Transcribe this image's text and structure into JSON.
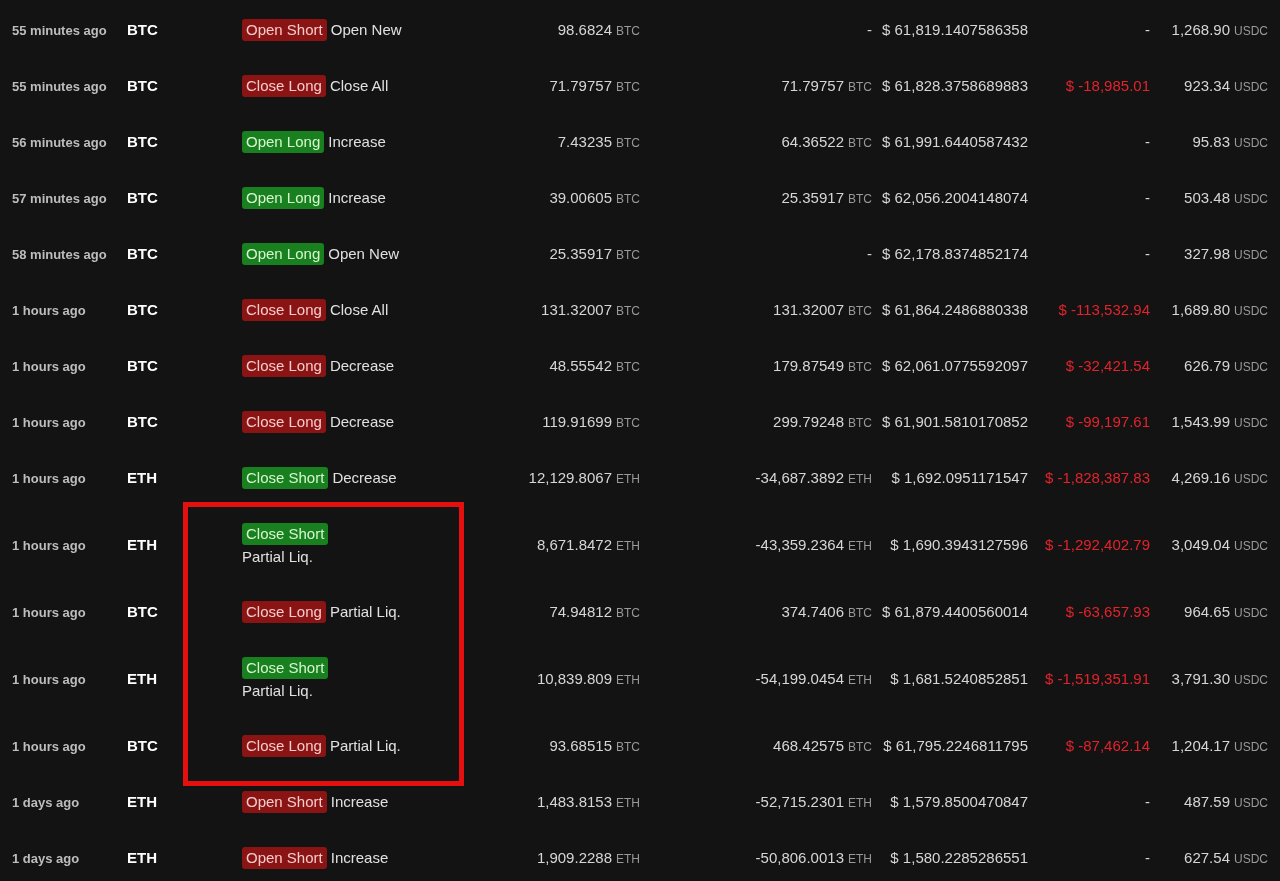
{
  "trades": [
    {
      "time": "55 minutes ago",
      "coin": "BTC",
      "side": {
        "label": "Open Short",
        "kind": "sell"
      },
      "action": "Open New",
      "size": {
        "value": "98.6824",
        "unit": "BTC"
      },
      "position": {
        "value": "-"
      },
      "price": "$ 61,819.1407586358",
      "pnl": {
        "value": "-",
        "kind": "neutral"
      },
      "fee": {
        "value": "1,268.90",
        "unit": "USDC"
      }
    },
    {
      "time": "55 minutes ago",
      "coin": "BTC",
      "side": {
        "label": "Close Long",
        "kind": "sell"
      },
      "action": "Close All",
      "size": {
        "value": "71.79757",
        "unit": "BTC"
      },
      "position": {
        "value": "71.79757",
        "unit": "BTC"
      },
      "price": "$ 61,828.3758689883",
      "pnl": {
        "value": "$ -18,985.01",
        "kind": "loss"
      },
      "fee": {
        "value": "923.34",
        "unit": "USDC"
      }
    },
    {
      "time": "56 minutes ago",
      "coin": "BTC",
      "side": {
        "label": "Open Long",
        "kind": "buy"
      },
      "action": "Increase",
      "size": {
        "value": "7.43235",
        "unit": "BTC"
      },
      "position": {
        "value": "64.36522",
        "unit": "BTC"
      },
      "price": "$ 61,991.6440587432",
      "pnl": {
        "value": "-",
        "kind": "neutral"
      },
      "fee": {
        "value": "95.83",
        "unit": "USDC"
      }
    },
    {
      "time": "57 minutes ago",
      "coin": "BTC",
      "side": {
        "label": "Open Long",
        "kind": "buy"
      },
      "action": "Increase",
      "size": {
        "value": "39.00605",
        "unit": "BTC"
      },
      "position": {
        "value": "25.35917",
        "unit": "BTC"
      },
      "price": "$ 62,056.2004148074",
      "pnl": {
        "value": "-",
        "kind": "neutral"
      },
      "fee": {
        "value": "503.48",
        "unit": "USDC"
      }
    },
    {
      "time": "58 minutes ago",
      "coin": "BTC",
      "side": {
        "label": "Open Long",
        "kind": "buy"
      },
      "action": "Open New",
      "size": {
        "value": "25.35917",
        "unit": "BTC"
      },
      "position": {
        "value": "-"
      },
      "price": "$ 62,178.8374852174",
      "pnl": {
        "value": "-",
        "kind": "neutral"
      },
      "fee": {
        "value": "327.98",
        "unit": "USDC"
      }
    },
    {
      "time": "1 hours ago",
      "coin": "BTC",
      "side": {
        "label": "Close Long",
        "kind": "sell"
      },
      "action": "Close All",
      "size": {
        "value": "131.32007",
        "unit": "BTC"
      },
      "position": {
        "value": "131.32007",
        "unit": "BTC"
      },
      "price": "$ 61,864.2486880338",
      "pnl": {
        "value": "$ -113,532.94",
        "kind": "loss"
      },
      "fee": {
        "value": "1,689.80",
        "unit": "USDC"
      }
    },
    {
      "time": "1 hours ago",
      "coin": "BTC",
      "side": {
        "label": "Close Long",
        "kind": "sell"
      },
      "action": "Decrease",
      "size": {
        "value": "48.55542",
        "unit": "BTC"
      },
      "position": {
        "value": "179.87549",
        "unit": "BTC"
      },
      "price": "$ 62,061.0775592097",
      "pnl": {
        "value": "$ -32,421.54",
        "kind": "loss"
      },
      "fee": {
        "value": "626.79",
        "unit": "USDC"
      }
    },
    {
      "time": "1 hours ago",
      "coin": "BTC",
      "side": {
        "label": "Close Long",
        "kind": "sell"
      },
      "action": "Decrease",
      "size": {
        "value": "119.91699",
        "unit": "BTC"
      },
      "position": {
        "value": "299.79248",
        "unit": "BTC"
      },
      "price": "$ 61,901.5810170852",
      "pnl": {
        "value": "$ -99,197.61",
        "kind": "loss"
      },
      "fee": {
        "value": "1,543.99",
        "unit": "USDC"
      }
    },
    {
      "time": "1 hours ago",
      "coin": "ETH",
      "side": {
        "label": "Close Short",
        "kind": "buy"
      },
      "action": "Decrease",
      "size": {
        "value": "12,129.8067",
        "unit": "ETH"
      },
      "position": {
        "value": "-34,687.3892",
        "unit": "ETH"
      },
      "price": "$ 1,692.0951171547",
      "pnl": {
        "value": "$ -1,828,387.83",
        "kind": "loss"
      },
      "fee": {
        "value": "4,269.16",
        "unit": "USDC"
      }
    },
    {
      "time": "1 hours ago",
      "coin": "ETH",
      "side": {
        "label": "Close Short",
        "kind": "buy"
      },
      "action": "Partial Liq.",
      "size": {
        "value": "8,671.8472",
        "unit": "ETH"
      },
      "position": {
        "value": "-43,359.2364",
        "unit": "ETH"
      },
      "price": "$ 1,690.3943127596",
      "pnl": {
        "value": "$ -1,292,402.79",
        "kind": "loss"
      },
      "fee": {
        "value": "3,049.04",
        "unit": "USDC"
      }
    },
    {
      "time": "1 hours ago",
      "coin": "BTC",
      "side": {
        "label": "Close Long",
        "kind": "sell"
      },
      "action": "Partial Liq.",
      "size": {
        "value": "74.94812",
        "unit": "BTC"
      },
      "position": {
        "value": "374.7406",
        "unit": "BTC"
      },
      "price": "$ 61,879.4400560014",
      "pnl": {
        "value": "$ -63,657.93",
        "kind": "loss"
      },
      "fee": {
        "value": "964.65",
        "unit": "USDC"
      }
    },
    {
      "time": "1 hours ago",
      "coin": "ETH",
      "side": {
        "label": "Close Short",
        "kind": "buy"
      },
      "action": "Partial Liq.",
      "size": {
        "value": "10,839.809",
        "unit": "ETH"
      },
      "position": {
        "value": "-54,199.0454",
        "unit": "ETH"
      },
      "price": "$ 1,681.5240852851",
      "pnl": {
        "value": "$ -1,519,351.91",
        "kind": "loss"
      },
      "fee": {
        "value": "3,791.30",
        "unit": "USDC"
      }
    },
    {
      "time": "1 hours ago",
      "coin": "BTC",
      "side": {
        "label": "Close Long",
        "kind": "sell"
      },
      "action": "Partial Liq.",
      "size": {
        "value": "93.68515",
        "unit": "BTC"
      },
      "position": {
        "value": "468.42575",
        "unit": "BTC"
      },
      "price": "$ 61,795.2246811795",
      "pnl": {
        "value": "$ -87,462.14",
        "kind": "loss"
      },
      "fee": {
        "value": "1,204.17",
        "unit": "USDC"
      }
    },
    {
      "time": "1 days ago",
      "coin": "ETH",
      "side": {
        "label": "Open Short",
        "kind": "sell"
      },
      "action": "Increase",
      "size": {
        "value": "1,483.8153",
        "unit": "ETH"
      },
      "position": {
        "value": "-52,715.2301",
        "unit": "ETH"
      },
      "price": "$ 1,579.8500470847",
      "pnl": {
        "value": "-",
        "kind": "neutral"
      },
      "fee": {
        "value": "487.59",
        "unit": "USDC"
      }
    },
    {
      "time": "1 days ago",
      "coin": "ETH",
      "side": {
        "label": "Open Short",
        "kind": "sell"
      },
      "action": "Increase",
      "size": {
        "value": "1,909.2288",
        "unit": "ETH"
      },
      "position": {
        "value": "-50,806.0013",
        "unit": "ETH"
      },
      "price": "$ 1,580.2285286551",
      "pnl": {
        "value": "-",
        "kind": "neutral"
      },
      "fee": {
        "value": "627.54",
        "unit": "USDC"
      }
    }
  ]
}
